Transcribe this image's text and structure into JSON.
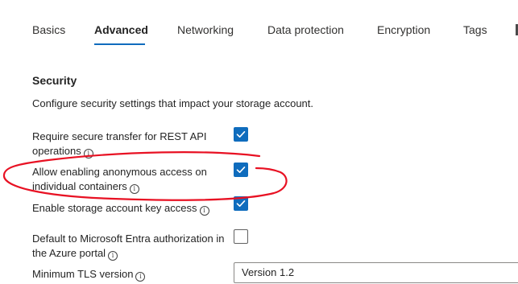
{
  "tabs": [
    {
      "label": "Basics",
      "active": false
    },
    {
      "label": "Advanced",
      "active": true
    },
    {
      "label": "Networking",
      "active": false
    },
    {
      "label": "Data protection",
      "active": false
    },
    {
      "label": "Encryption",
      "active": false
    },
    {
      "label": "Tags",
      "active": false
    }
  ],
  "section": {
    "title": "Security",
    "description": "Configure security settings that impact your storage account."
  },
  "settings": [
    {
      "label": "Require secure transfer for REST API operations",
      "checked": true,
      "info_icon": "info-icon"
    },
    {
      "label": "Allow enabling anonymous access on individual containers",
      "checked": true,
      "info_icon": "info-icon"
    },
    {
      "label": "Enable storage account key access",
      "checked": true,
      "info_icon": "info-icon"
    },
    {
      "label": "Default to Microsoft Entra authorization in the Azure portal",
      "checked": false,
      "info_icon": "info-icon"
    }
  ],
  "tls": {
    "label": "Minimum TLS version",
    "value": "Version 1.2"
  },
  "colors": {
    "accent": "#0f6cbd",
    "annotation": "#e81123"
  }
}
